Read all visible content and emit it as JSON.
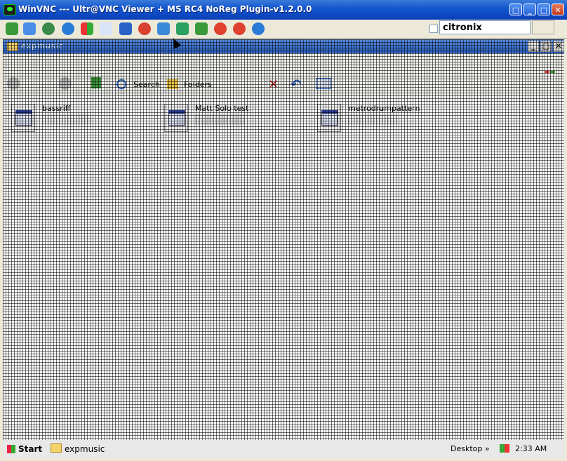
{
  "window": {
    "title": "WinVNC --- Ultr@VNC Viewer + MS RC4 NoReg Plugin-v1.2.0.0"
  },
  "vnc_toolbar": {
    "icons": [
      "connect-icon",
      "fullscreen-icon",
      "refresh-icon",
      "sync-icon",
      "windows-icon",
      "text-abc-icon",
      "info-icon",
      "stop-icon",
      "file-transfer-icon",
      "tools-icon",
      "swap-icon",
      "target-icon",
      "target-alt-icon",
      "chat-icon"
    ],
    "host_value": "citronix"
  },
  "remote": {
    "explorer_title": "expmusic",
    "toolbar": {
      "search_label": "Search",
      "folders_label": "Folders"
    },
    "files": [
      {
        "name": "bassriff"
      },
      {
        "name": "Matt Solo test"
      },
      {
        "name": "metrodrumpattern"
      }
    ],
    "taskbar": {
      "start_label": "Start",
      "task_label": "expmusic",
      "desktop_label": "Desktop",
      "clock": "2:33 AM"
    }
  },
  "colors": {
    "titlebar": "#1457d0",
    "close": "#c0391c"
  }
}
